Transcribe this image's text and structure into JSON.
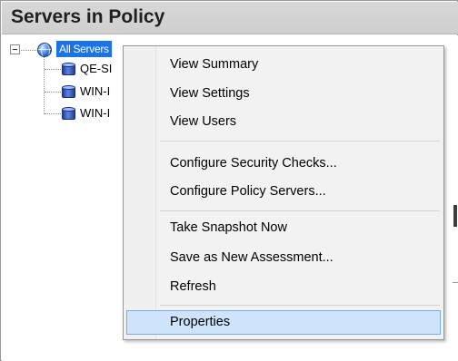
{
  "panel": {
    "title": "Servers in Policy"
  },
  "tree": {
    "root": {
      "label": "All Servers",
      "icon": "globe-icon",
      "expanded": true
    },
    "children": [
      {
        "label": "QE-SI",
        "icon": "database-server-icon"
      },
      {
        "label": "WIN-I",
        "icon": "database-server-icon"
      },
      {
        "label": "WIN-I",
        "icon": "database-server-icon"
      }
    ]
  },
  "context_menu": {
    "items": [
      {
        "label": "View Summary"
      },
      {
        "label": "View Settings"
      },
      {
        "label": "View Users"
      },
      {
        "label": "Configure Security Checks..."
      },
      {
        "label": "Configure Policy Servers..."
      },
      {
        "label": "Take Snapshot Now"
      },
      {
        "label": "Save as New Assessment..."
      },
      {
        "label": "Refresh"
      },
      {
        "label": "Properties",
        "selected": true
      }
    ]
  },
  "colors": {
    "selection_blue": "#1a73e8",
    "menu_highlight": "#cde4fb",
    "menu_highlight_border": "#78aee5",
    "header_gray": "#d4d4d4"
  }
}
